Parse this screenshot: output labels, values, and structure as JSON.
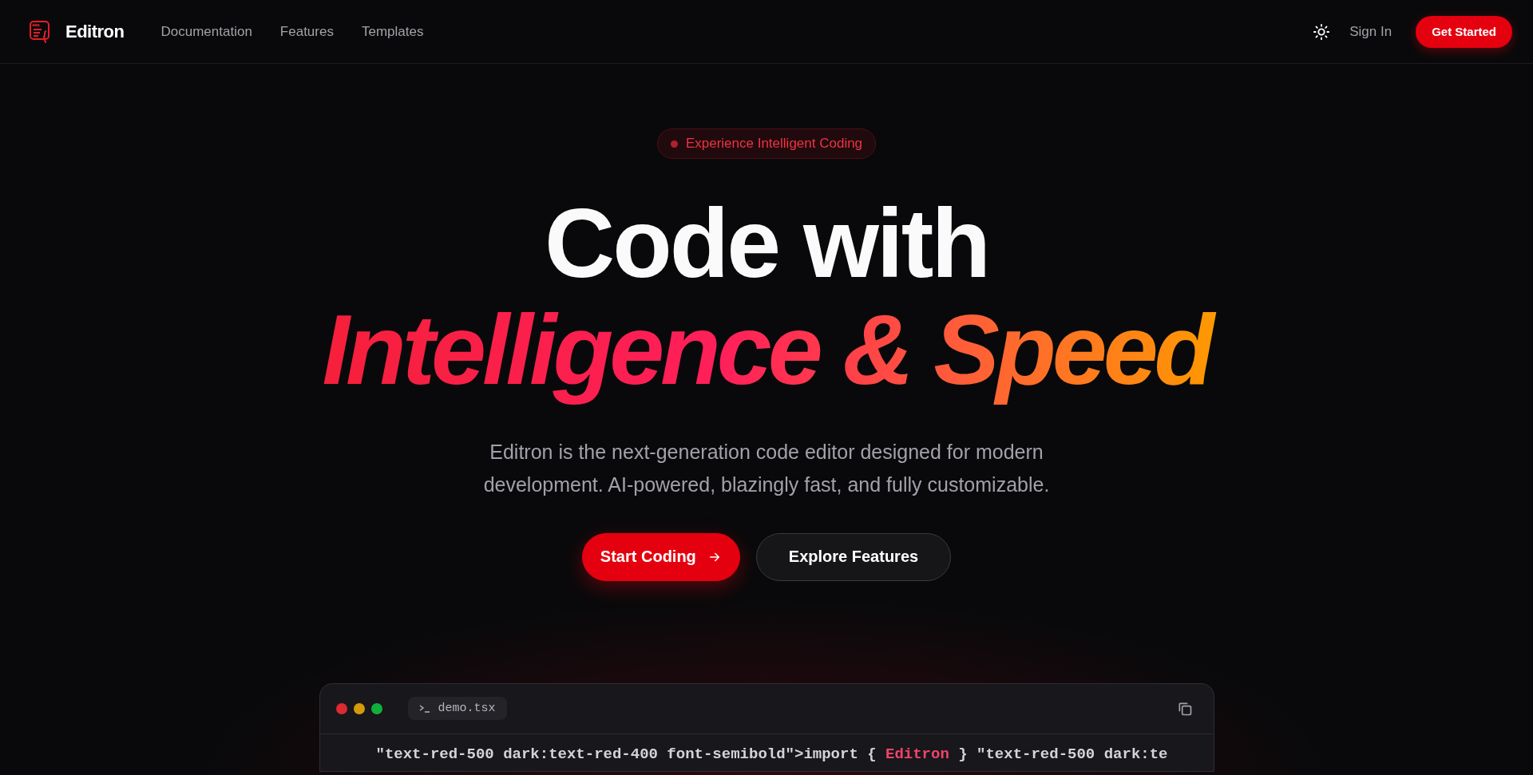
{
  "header": {
    "brand": "Editron",
    "nav": [
      {
        "label": "Documentation"
      },
      {
        "label": "Features"
      },
      {
        "label": "Templates"
      }
    ],
    "sign_in": "Sign In",
    "cta": "Get Started"
  },
  "hero": {
    "badge": "Experience Intelligent Coding",
    "title_line_1": "Code with",
    "title_line_2": "Intelligence & Speed",
    "subtitle": "Editron is the next-generation code editor designed for modern development. AI-powered, blazingly fast, and fully customizable.",
    "buttons": [
      {
        "label": "Start Coding",
        "kind": "primary"
      },
      {
        "label": "Explore Features",
        "kind": "secondary"
      }
    ]
  },
  "editor": {
    "file_tab": "demo.tsx",
    "code_line": [
      {
        "text": "\"text-red-500 dark:text-red-400 font-semibold\">import { ",
        "kind": "plain"
      },
      {
        "text": "Editron",
        "kind": "highlight"
      },
      {
        "text": " } \"text-red-500 dark:te",
        "kind": "plain"
      }
    ]
  }
}
